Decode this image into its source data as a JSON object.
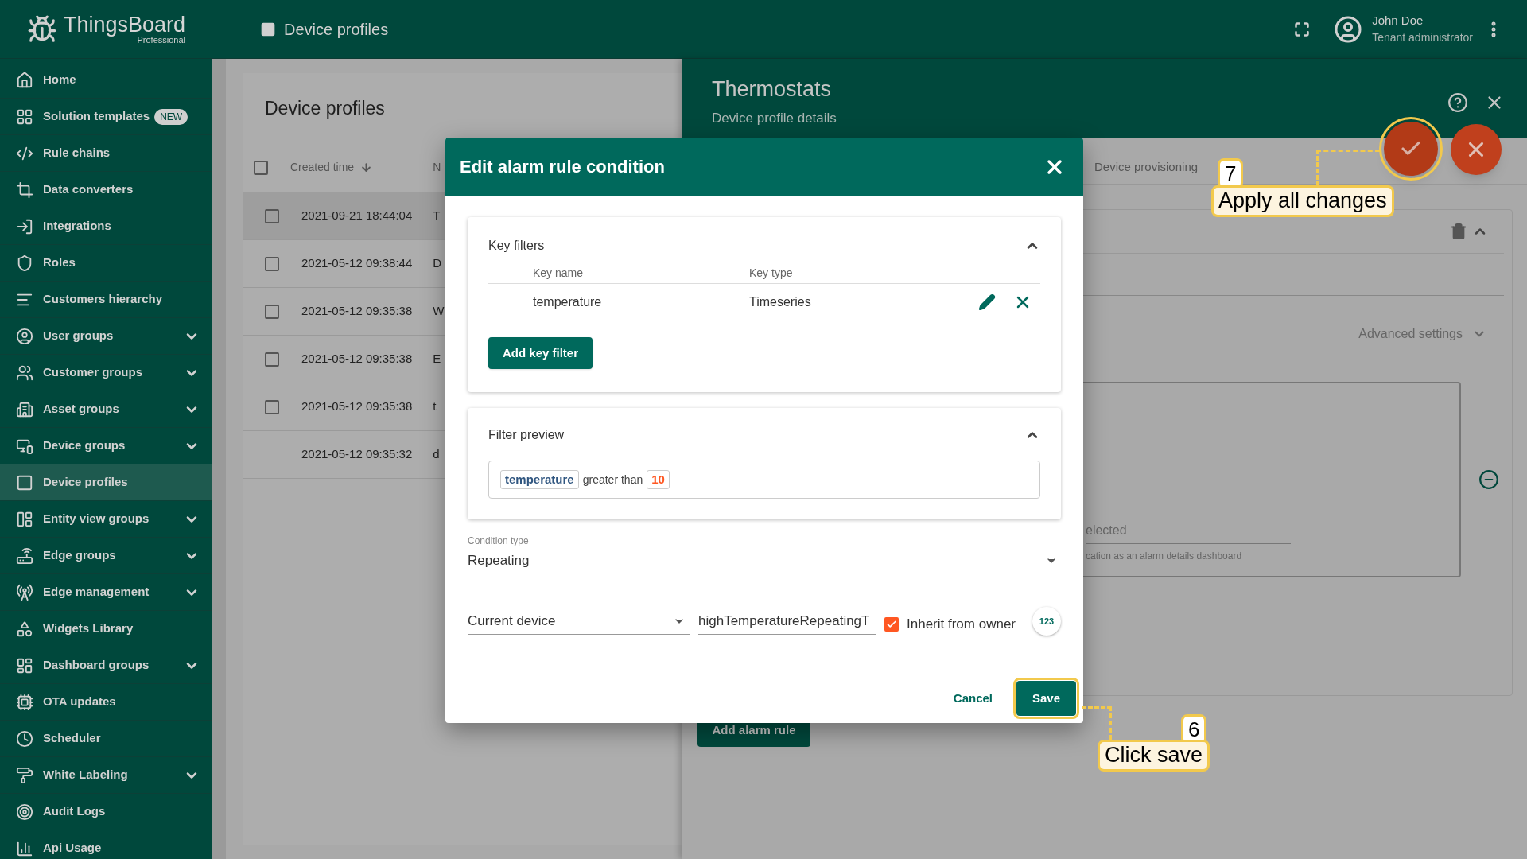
{
  "app": {
    "logo": "ThingsBoard",
    "edition": "Professional"
  },
  "header": {
    "title": "Device profiles",
    "user_name": "John Doe",
    "user_role": "Tenant administrator"
  },
  "sidebar": {
    "items": [
      {
        "label": "Home",
        "selected": false,
        "expandable": false
      },
      {
        "label": "Solution templates",
        "selected": false,
        "expandable": false,
        "badge": "NEW"
      },
      {
        "label": "Rule chains",
        "selected": false,
        "expandable": false
      },
      {
        "label": "Data converters",
        "selected": false,
        "expandable": false
      },
      {
        "label": "Integrations",
        "selected": false,
        "expandable": false
      },
      {
        "label": "Roles",
        "selected": false,
        "expandable": false
      },
      {
        "label": "Customers hierarchy",
        "selected": false,
        "expandable": false
      },
      {
        "label": "User groups",
        "selected": false,
        "expandable": true
      },
      {
        "label": "Customer groups",
        "selected": false,
        "expandable": true
      },
      {
        "label": "Asset groups",
        "selected": false,
        "expandable": true
      },
      {
        "label": "Device groups",
        "selected": false,
        "expandable": true
      },
      {
        "label": "Device profiles",
        "selected": true,
        "expandable": false
      },
      {
        "label": "Entity view groups",
        "selected": false,
        "expandable": true
      },
      {
        "label": "Edge groups",
        "selected": false,
        "expandable": true
      },
      {
        "label": "Edge management",
        "selected": false,
        "expandable": true
      },
      {
        "label": "Widgets Library",
        "selected": false,
        "expandable": false
      },
      {
        "label": "Dashboard groups",
        "selected": false,
        "expandable": true
      },
      {
        "label": "OTA updates",
        "selected": false,
        "expandable": false
      },
      {
        "label": "Scheduler",
        "selected": false,
        "expandable": false
      },
      {
        "label": "White Labeling",
        "selected": false,
        "expandable": true
      },
      {
        "label": "Audit Logs",
        "selected": false,
        "expandable": false
      },
      {
        "label": "Api Usage",
        "selected": false,
        "expandable": false
      }
    ]
  },
  "list": {
    "title": "Device profiles",
    "select_all": {
      "checked": false
    },
    "columns": [
      "Created time",
      "N"
    ],
    "rows": [
      {
        "created": "2021-09-21 18:44:04",
        "name": "T",
        "selectable": true,
        "selected": true
      },
      {
        "created": "2021-05-12 09:38:44",
        "name": "D",
        "selectable": true,
        "selected": false
      },
      {
        "created": "2021-05-12 09:35:38",
        "name": "W",
        "selectable": true,
        "selected": false
      },
      {
        "created": "2021-05-12 09:35:38",
        "name": "E",
        "selectable": true,
        "selected": false
      },
      {
        "created": "2021-05-12 09:35:38",
        "name": "t",
        "selectable": true,
        "selected": false
      },
      {
        "created": "2021-05-12 09:35:32",
        "name": "d",
        "selectable": false,
        "selected": false
      }
    ]
  },
  "details": {
    "title": "Thermostats",
    "subtitle": "Device profile details",
    "tab": "Device provisioning",
    "advanced": "Advanced settings",
    "dashboard_value": "elected",
    "dashboard_hint": "cation as an alarm details dashboard",
    "add_button": "Add alarm rule"
  },
  "dialog": {
    "title": "Edit alarm rule condition",
    "key_filters": {
      "title": "Key filters",
      "columns": [
        "Key name",
        "Key type"
      ],
      "rows": [
        {
          "name": "temperature",
          "type": "Timeseries"
        }
      ],
      "add_button": "Add key filter"
    },
    "preview": {
      "title": "Filter preview",
      "key": "temperature",
      "operation": "greater than",
      "value": "10"
    },
    "condition_type": {
      "label": "Condition type",
      "value": "Repeating"
    },
    "source": "Current device",
    "attribute": "highTemperatureRepeatingT",
    "inherit": {
      "label": "Inherit from owner",
      "checked": true
    },
    "value_type": "123",
    "cancel": "Cancel",
    "save": "Save"
  },
  "callouts": [
    {
      "number": "7",
      "text": "Apply all changes"
    },
    {
      "number": "6",
      "text": "Click save"
    }
  ]
}
